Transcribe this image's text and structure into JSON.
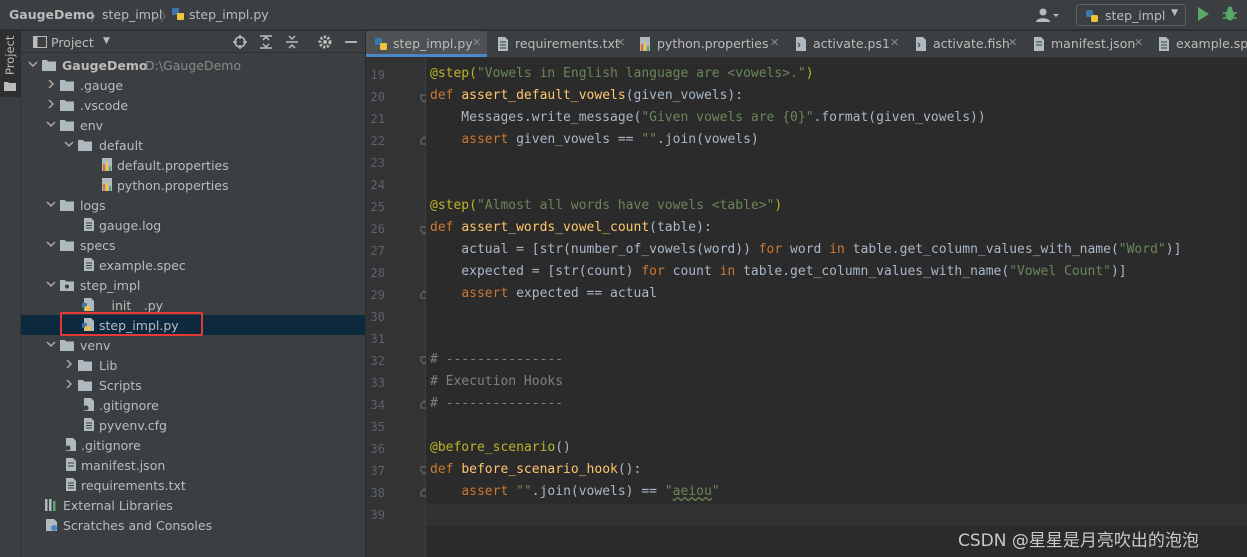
{
  "titlebar": {
    "project": "GaugeDemo",
    "breadcrumb_folder": "step_impl",
    "breadcrumb_file": "step_impl.py",
    "run_config": "step_impl"
  },
  "sidebar_tab": "Project",
  "panel": {
    "title": "Project"
  },
  "tree": [
    {
      "label": "GaugeDemo",
      "path": "D:\\GaugeDemo"
    },
    {
      "label": ".gauge"
    },
    {
      "label": ".vscode"
    },
    {
      "label": "env"
    },
    {
      "label": "default"
    },
    {
      "label": "default.properties"
    },
    {
      "label": "python.properties"
    },
    {
      "label": "logs"
    },
    {
      "label": "gauge.log"
    },
    {
      "label": "specs"
    },
    {
      "label": "example.spec"
    },
    {
      "label": "step_impl"
    },
    {
      "label": "__init__.py"
    },
    {
      "label": "step_impl.py"
    },
    {
      "label": "venv"
    },
    {
      "label": "Lib"
    },
    {
      "label": "Scripts"
    },
    {
      "label": ".gitignore"
    },
    {
      "label": "pyvenv.cfg"
    },
    {
      "label": ".gitignore"
    },
    {
      "label": "manifest.json"
    },
    {
      "label": "requirements.txt"
    },
    {
      "label": "External Libraries"
    },
    {
      "label": "Scratches and Consoles"
    }
  ],
  "tabs": [
    {
      "label": "step_impl.py"
    },
    {
      "label": "requirements.txt"
    },
    {
      "label": "python.properties"
    },
    {
      "label": "activate.ps1"
    },
    {
      "label": "activate.fish"
    },
    {
      "label": "manifest.json"
    },
    {
      "label": "example.spec"
    }
  ],
  "line_numbers": [
    "19",
    "20",
    "21",
    "22",
    "23",
    "24",
    "25",
    "26",
    "27",
    "28",
    "29",
    "30",
    "31",
    "32",
    "33",
    "34",
    "35",
    "36",
    "37",
    "38",
    "39"
  ],
  "code": {
    "l19": {
      "a": "@step(",
      "b": "\"Vowels in English language are <vowels>.\"",
      "c": ")"
    },
    "l20": {
      "a": "def ",
      "b": "assert_default_vowels",
      "c": "(given_vowels):"
    },
    "l21": {
      "a": "    Messages.write_message(",
      "b": "\"Given vowels are {0}\"",
      "c": ".format(given_vowels))"
    },
    "l22": {
      "a": "    ",
      "b": "assert",
      "c": " given_vowels == ",
      "d": "\"\"",
      "e": ".join(vowels)"
    },
    "l25": {
      "a": "@step(",
      "b": "\"Almost all words have vowels <table>\"",
      "c": ")"
    },
    "l26": {
      "a": "def ",
      "b": "assert_words_vowel_count",
      "c": "(table):"
    },
    "l27": {
      "a": "    actual = [str(number_of_vowels(word)) ",
      "b": "for",
      "c": " word ",
      "d": "in",
      "e": " table.get_column_values_with_name(",
      "f": "\"Word\"",
      "g": ")]"
    },
    "l28": {
      "a": "    expected = [str(count) ",
      "b": "for",
      "c": " count ",
      "d": "in",
      "e": " table.get_column_values_with_name(",
      "f": "\"Vowel Count\"",
      "g": ")]"
    },
    "l29": {
      "a": "    ",
      "b": "assert",
      "c": " expected == actual"
    },
    "l32": "# ---------------",
    "l33": "# Execution Hooks",
    "l34": "# ---------------",
    "l36": {
      "a": "@before_scenario",
      "b": "()"
    },
    "l37": {
      "a": "def ",
      "b": "before_scenario_hook",
      "c": "():"
    },
    "l38": {
      "a": "    ",
      "b": "assert",
      "c": " ",
      "d": "\"\"",
      "e": ".join(vowels) == ",
      "f": "\"",
      "g": "aeiou",
      "h": "\""
    }
  },
  "watermark": "CSDN @星星是月亮吹出的泡泡",
  "colors": {
    "accent": "#4a88c7",
    "selection": "#0d293e",
    "highlight_box": "#e53935",
    "run": "#59a869"
  }
}
